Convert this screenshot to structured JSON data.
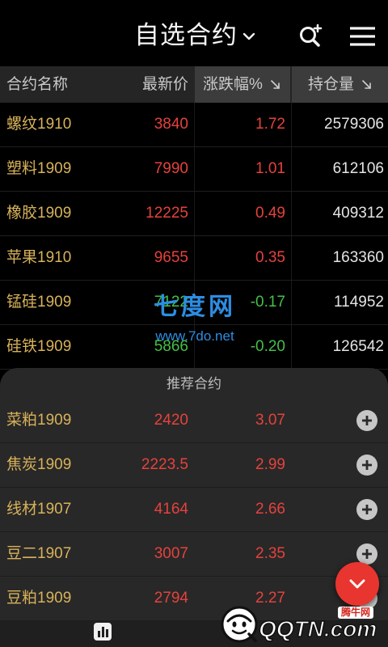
{
  "header": {
    "title": "自选合约",
    "title_icon": "chevron-down-icon",
    "search_icon": "search-plus-icon",
    "menu_icon": "hamburger-menu-icon"
  },
  "colors": {
    "up": "#e5423d",
    "down": "#45bf47",
    "contract_name": "#d8b25a",
    "fab": "#e8352f",
    "watermark": "#2d8de2"
  },
  "table": {
    "columns": [
      {
        "label": "合约名称"
      },
      {
        "label": "最新价"
      },
      {
        "label": "涨跌幅%",
        "sort_icon": "sort-descending-icon"
      },
      {
        "label": "持仓量",
        "sort_icon": "sort-descending-icon"
      }
    ],
    "rows": [
      {
        "name": "螺纹1910",
        "price": "3840",
        "change_pct": "1.72",
        "open_interest": "2579306"
      },
      {
        "name": "塑料1909",
        "price": "7990",
        "change_pct": "1.01",
        "open_interest": "612106"
      },
      {
        "name": "橡胶1909",
        "price": "12225",
        "change_pct": "0.49",
        "open_interest": "409312"
      },
      {
        "name": "苹果1910",
        "price": "9655",
        "change_pct": "0.35",
        "open_interest": "163360"
      },
      {
        "name": "锰硅1909",
        "price": "7122",
        "change_pct": "-0.17",
        "open_interest": "114952"
      },
      {
        "name": "硅铁1909",
        "price": "5866",
        "change_pct": "-0.20",
        "open_interest": "126542"
      }
    ]
  },
  "recommended": {
    "title": "推荐合约",
    "action_icon": "plus-circle-icon",
    "rows": [
      {
        "name": "菜粕1909",
        "price": "2420",
        "change_pct": "3.07"
      },
      {
        "name": "焦炭1909",
        "price": "2223.5",
        "change_pct": "2.99"
      },
      {
        "name": "线材1907",
        "price": "4164",
        "change_pct": "2.66"
      },
      {
        "name": "豆二1907",
        "price": "3007",
        "change_pct": "2.35"
      },
      {
        "name": "豆粕1909",
        "price": "2794",
        "change_pct": "2.27"
      }
    ]
  },
  "bottom_bar": {
    "items": [
      {
        "icon": "bar-chart-icon"
      }
    ]
  },
  "fab": {
    "icon": "chevron-down-icon"
  },
  "watermarks": {
    "site_a_name": "七度网",
    "site_a_url": "www.7do.net",
    "site_b_text": "QQTN.com",
    "site_b_badge": "腾牛网"
  }
}
